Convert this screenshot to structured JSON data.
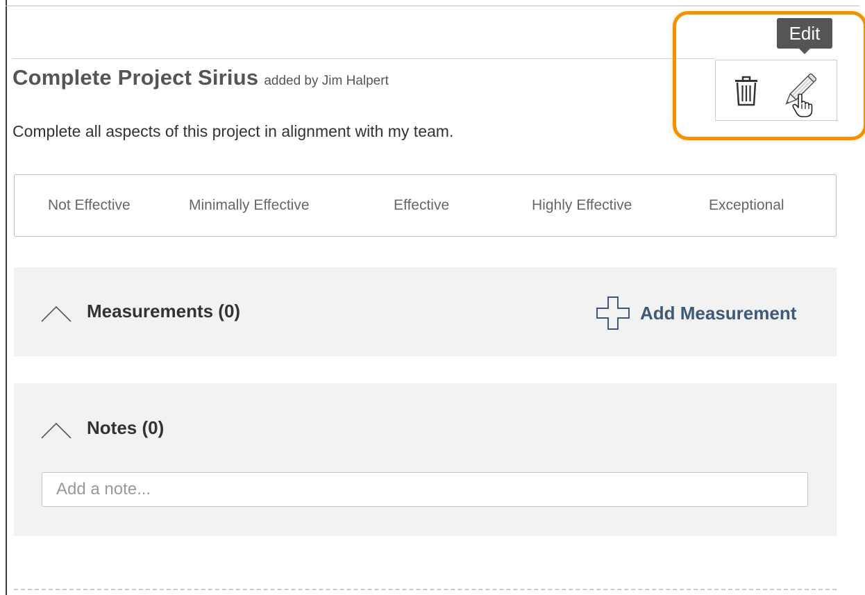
{
  "goal": {
    "title": "Complete Project Sirius",
    "added_by": "added by Jim Halpert",
    "description": "Complete all aspects of this project in alignment with my team."
  },
  "actions": {
    "delete_icon": "trash-icon",
    "edit_icon": "pencil-icon",
    "cursor_icon": "hand-pointer-icon",
    "tooltip": "Edit",
    "highlight_color": "#f29200"
  },
  "rating": {
    "options": [
      "Not Effective",
      "Minimally Effective",
      "Effective",
      "Highly Effective",
      "Exceptional"
    ]
  },
  "measurements": {
    "title": "Measurements (0)",
    "add_label": "Add Measurement",
    "add_icon": "plus-icon",
    "collapse_icon": "chevron-up-icon",
    "link_color": "#3c5a78"
  },
  "notes": {
    "title": "Notes (0)",
    "collapse_icon": "chevron-up-icon",
    "input_placeholder": "Add a note...",
    "input_value": ""
  }
}
